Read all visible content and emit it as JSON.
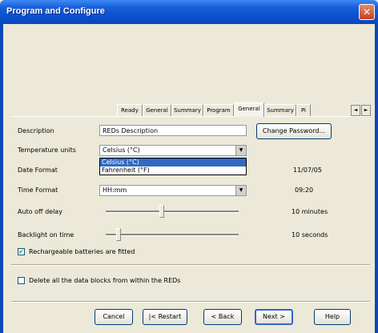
{
  "window": {
    "title": "Program and Configure",
    "close": "✕"
  },
  "tabs": [
    "Ready",
    "General",
    "Summary",
    "Program",
    "General",
    "Summary",
    "Pi"
  ],
  "tab_scroll": {
    "left": "◄",
    "right": "►"
  },
  "fields": {
    "description": {
      "label": "Description",
      "value": "REDs Description"
    },
    "change_password": "Change Password...",
    "temperature": {
      "label": "Temperature units",
      "value": "Celsius (°C)",
      "options": [
        "Celsius (°C)",
        "Fahrenheit (°F)"
      ]
    },
    "date_format": {
      "label": "Date Format",
      "value": "11/07/05"
    },
    "time_format": {
      "label": "Time Format",
      "selected": "HH:mm",
      "value": "09:20"
    },
    "auto_off": {
      "label": "Auto off delay",
      "value": "10 minutes",
      "level": 0.42
    },
    "backlight": {
      "label": "Backlight on time",
      "value": "10 seconds",
      "level": 0.08
    },
    "rechargeable": {
      "label": "Rechargeable batteries are fitted",
      "checked": true
    },
    "delete_blocks": {
      "label": "Delete all the data blocks from within the REDs",
      "checked": false
    }
  },
  "buttons": {
    "cancel": "Cancel",
    "restart": "|< Restart",
    "back": "< Back",
    "next": "Next >",
    "help": "Help"
  }
}
